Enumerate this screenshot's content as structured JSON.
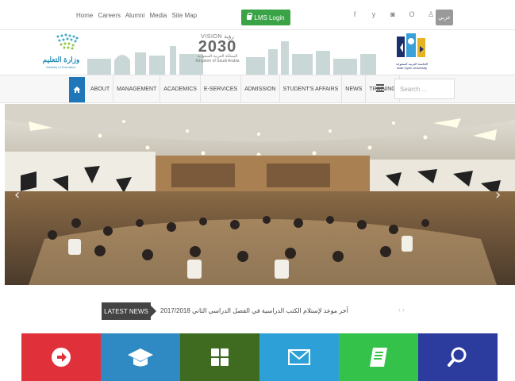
{
  "topbar": {
    "links": [
      "Home",
      "Careers",
      "Alumni",
      "Media",
      "Site Map"
    ],
    "lms_label": "LMS Login",
    "social_icons": [
      "facebook-icon",
      "twitter-icon",
      "instagram-icon",
      "circle-icon",
      "person-icon"
    ],
    "social_glyphs": [
      "f",
      "y",
      "◙",
      "O",
      "♙"
    ],
    "arabic_label": "عربي"
  },
  "header": {
    "moe_ar": "وزارة التعليم",
    "moe_en": "Ministry of Education",
    "vision_top": "VISION رؤية",
    "vision_year": "2030",
    "vision_ar": "المملكة العربية السعودية",
    "vision_en": "Kingdom of Saudi Arabia",
    "aou_ar": "الجامعة العربية المفتوحة",
    "aou_en": "Arab Open University"
  },
  "nav": {
    "items": [
      "ABOUT",
      "MANAGEMENT",
      "ACADEMICS",
      "E-SERVICES",
      "ADMISSION",
      "STUDENT'S AFFAIRS",
      "NEWS",
      "TRAINING"
    ],
    "search_placeholder": "Search ..."
  },
  "hero": {
    "prev": "‹",
    "next": "›"
  },
  "news": {
    "label": "LATEST NEWS",
    "text": "آخر موعد لإستلام الكتب الدراسية في الفصل الدراسي الثاني 2017/2018",
    "controls": "‹  ›"
  },
  "tiles": [
    {
      "color": "#e0313a",
      "icon": "arrow-right-circle-icon"
    },
    {
      "color": "#2f8ac4",
      "icon": "graduation-cap-icon"
    },
    {
      "color": "#3e6b1f",
      "icon": "grid-icon"
    },
    {
      "color": "#2ea0d8",
      "icon": "envelope-icon"
    },
    {
      "color": "#35c24a",
      "icon": "book-icon"
    },
    {
      "color": "#2b3b9e",
      "icon": "search-icon"
    }
  ]
}
